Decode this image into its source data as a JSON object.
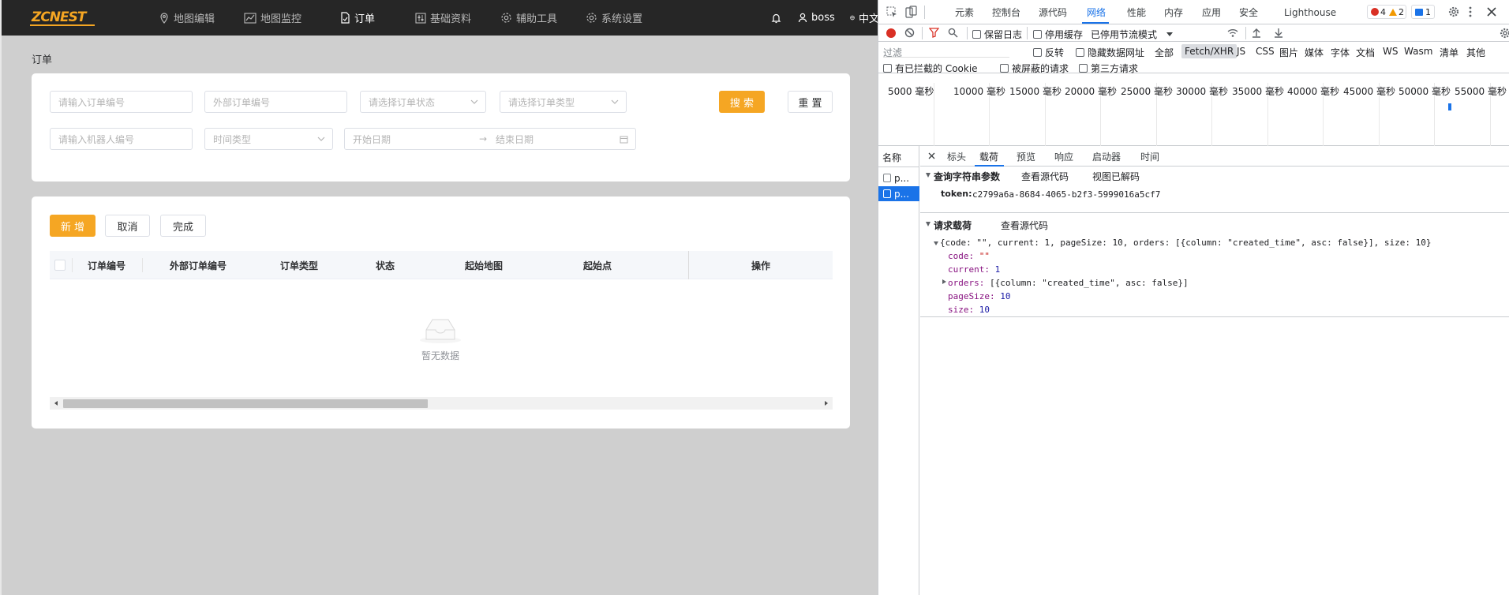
{
  "app": {
    "logo": "ZCNEST",
    "nav": [
      {
        "label": "地图编辑",
        "icon": "location-pin-icon"
      },
      {
        "label": "地图监控",
        "icon": "line-chart-icon"
      },
      {
        "label": "订单",
        "icon": "document-icon",
        "active": true
      },
      {
        "label": "基础资料",
        "icon": "sliders-icon"
      },
      {
        "label": "辅助工具",
        "icon": "gear-icon"
      },
      {
        "label": "系统设置",
        "icon": "gear-icon"
      }
    ],
    "user": "boss",
    "lang": "中文",
    "breadcrumb": "订单",
    "accent_color": "#f5a623"
  },
  "search_form": {
    "order_no_placeholder": "请输入订单编号",
    "external_no_placeholder": "外部订单编号",
    "status_placeholder": "请选择订单状态",
    "type_placeholder": "请选择订单类型",
    "robot_placeholder": "请输入机器人编号",
    "time_type_placeholder": "时间类型",
    "start_date_placeholder": "开始日期",
    "date_separator": "→",
    "end_date_placeholder": "结束日期",
    "search_label": "搜 索",
    "reset_label": "重 置"
  },
  "table": {
    "actions": {
      "add": "新 增",
      "cancel": "取消",
      "finish": "完成"
    },
    "columns": [
      "订单编号",
      "外部订单编号",
      "订单类型",
      "状态",
      "起始地图",
      "起始点",
      "操作"
    ],
    "rows": [],
    "empty_text": "暂无数据"
  },
  "devtools": {
    "tabs": [
      "元素",
      "控制台",
      "源代码",
      "网络",
      "性能",
      "内存",
      "应用",
      "安全",
      "Lighthouse"
    ],
    "active_tab": "网络",
    "errors": "4",
    "warnings": "2",
    "messages": "1",
    "toolbar": {
      "preserve_log": "保留日志",
      "disable_cache": "停用缓存",
      "throttle": "已停用节流模式"
    },
    "filter": {
      "placeholder": "过滤",
      "invert": "反转",
      "hide_data_urls": "隐藏数据网址",
      "types": [
        "全部",
        "Fetch/XHR",
        "JS",
        "CSS",
        "图片",
        "媒体",
        "字体",
        "文档",
        "WS",
        "Wasm",
        "清单",
        "其他"
      ],
      "active_type": "Fetch/XHR",
      "blocked_cookies": "有已拦截的 Cookie",
      "blocked_requests": "被屏蔽的请求",
      "third_party": "第三方请求"
    },
    "timeline_ticks": [
      "5000 毫秒",
      "10000 毫秒",
      "15000 毫秒",
      "20000 毫秒",
      "25000 毫秒",
      "30000 毫秒",
      "35000 毫秒",
      "40000 毫秒",
      "45000 毫秒",
      "50000 毫秒",
      "55000 毫秒"
    ],
    "name_header": "名称",
    "requests": [
      "p...",
      "p..."
    ],
    "detail_tabs": [
      "标头",
      "载荷",
      "预览",
      "响应",
      "启动器",
      "时间"
    ],
    "active_detail_tab": "载荷",
    "query_section": {
      "title": "查询字符串参数",
      "view_source": "查看源代码",
      "view_decoded": "视图已解码",
      "token_key": "token:",
      "token_value": "c2799a6a-8684-4065-b2f3-5999016a5cf7"
    },
    "payload_section": {
      "title": "请求载荷",
      "view_source": "查看源代码",
      "summary": "{code: \"\", current: 1, pageSize: 10, orders: [{column: \"created_time\", asc: false}], size: 10}",
      "fields": [
        {
          "key": "code:",
          "value": "\"\"",
          "kind": "str"
        },
        {
          "key": "current:",
          "value": "1",
          "kind": "num"
        },
        {
          "key": "orders:",
          "value": "[{column: \"created_time\", asc: false}]",
          "kind": "plain"
        },
        {
          "key": "pageSize:",
          "value": "10",
          "kind": "num"
        },
        {
          "key": "size:",
          "value": "10",
          "kind": "num"
        }
      ]
    }
  }
}
